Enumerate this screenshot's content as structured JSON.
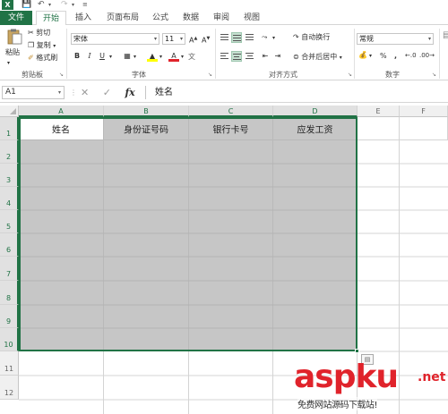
{
  "quick_access": {
    "logo_text": "X",
    "save_icon": "save-icon",
    "undo_icon": "undo-icon",
    "redo_icon": "redo-icon",
    "customize_icon": "customize-icon"
  },
  "tabs": [
    {
      "label": "文件"
    },
    {
      "label": "开始"
    },
    {
      "label": "插入"
    },
    {
      "label": "页面布局"
    },
    {
      "label": "公式"
    },
    {
      "label": "数据"
    },
    {
      "label": "审阅"
    },
    {
      "label": "视图"
    }
  ],
  "ribbon": {
    "clipboard": {
      "paste_label": "粘贴",
      "cut_label": "剪切",
      "copy_label": "复制",
      "format_painter_label": "格式刷",
      "group_label": "剪贴板"
    },
    "font": {
      "font_name": "宋体",
      "font_size": "11",
      "bold": "B",
      "italic": "I",
      "underline": "U",
      "group_label": "字体"
    },
    "alignment": {
      "wrap_text_label": "自动换行",
      "merge_label": "合并后居中",
      "group_label": "对齐方式"
    },
    "number": {
      "format_value": "常规",
      "percent": "%",
      "comma": ",",
      "group_label": "数字"
    }
  },
  "formula_bar": {
    "name_box": "A1",
    "fx_label": "fx",
    "value": "姓名"
  },
  "sheet": {
    "columns": [
      "A",
      "B",
      "C",
      "D",
      "E",
      "F"
    ],
    "rows": [
      "1",
      "2",
      "3",
      "4",
      "5",
      "6",
      "7",
      "8",
      "9",
      "10",
      "11",
      "12"
    ],
    "headers": [
      "姓名",
      "身份证号码",
      "银行卡号",
      "应发工资"
    ]
  },
  "watermark": {
    "main": "aspku",
    "net": ".net",
    "sub": "免费网站源码下载站!"
  },
  "colors": {
    "accent": "#217346",
    "selection_fill": "#c6c6c6",
    "watermark": "#e0232b"
  }
}
